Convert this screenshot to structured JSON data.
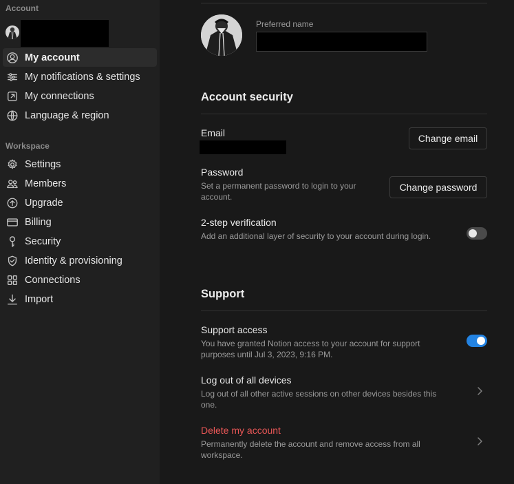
{
  "sidebar": {
    "account_label": "Account",
    "account_items": [
      {
        "label": "My account",
        "icon": "user-circle-icon",
        "active": true
      },
      {
        "label": "My notifications & settings",
        "icon": "sliders-icon"
      },
      {
        "label": "My connections",
        "icon": "external-link-icon"
      },
      {
        "label": "Language & region",
        "icon": "globe-icon"
      }
    ],
    "workspace_label": "Workspace",
    "workspace_items": [
      {
        "label": "Settings",
        "icon": "gear-icon"
      },
      {
        "label": "Members",
        "icon": "members-icon"
      },
      {
        "label": "Upgrade",
        "icon": "upgrade-icon"
      },
      {
        "label": "Billing",
        "icon": "credit-card-icon"
      },
      {
        "label": "Security",
        "icon": "key-icon"
      },
      {
        "label": "Identity & provisioning",
        "icon": "shield-check-icon"
      },
      {
        "label": "Connections",
        "icon": "grid-icon"
      },
      {
        "label": "Import",
        "icon": "import-icon"
      }
    ]
  },
  "profile": {
    "preferred_name_label": "Preferred name"
  },
  "security": {
    "heading": "Account security",
    "email_label": "Email",
    "change_email": "Change email",
    "password_label": "Password",
    "password_desc": "Set a permanent password to login to your account.",
    "change_password": "Change password",
    "two_step_label": "2-step verification",
    "two_step_desc": "Add an additional layer of security to your account during login.",
    "two_step_enabled": false
  },
  "support": {
    "heading": "Support",
    "access_label": "Support access",
    "access_desc": "You have granted Notion access to your account for support purposes until Jul 3, 2023, 9:16 PM.",
    "access_enabled": true,
    "logout_label": "Log out of all devices",
    "logout_desc": "Log out of all other active sessions on other devices besides this one.",
    "delete_label": "Delete my account",
    "delete_desc": "Permanently delete the account and remove access from all workspace."
  },
  "colors": {
    "accent": "#2383e2",
    "danger": "#eb5757",
    "sidebar_bg": "#202020",
    "main_bg": "#191919"
  }
}
